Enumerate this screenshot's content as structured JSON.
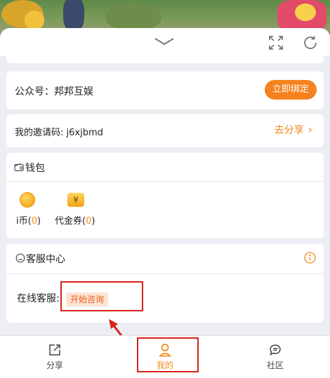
{
  "colors": {
    "accent": "#f5821f",
    "link": "#f08a1d",
    "highlight": "#d7221a",
    "tab_active": "#f08a1d"
  },
  "header": {
    "collapse_icon": "chevron-down-icon",
    "fullscreen_icon": "expand-icon",
    "refresh_icon": "refresh-icon"
  },
  "official_account": {
    "label": "公众号：邦邦互娱",
    "button": "立即绑定"
  },
  "invite": {
    "label": "我的邀请码: j6xjbmd",
    "share": "去分享",
    "arrow": "›"
  },
  "wallet": {
    "title": "钱包",
    "items": [
      {
        "name": "i币",
        "open": "(",
        "count": "0",
        "close": ")"
      },
      {
        "name": "代金券",
        "open": "(",
        "count": "0",
        "close": ")"
      }
    ],
    "voucher_symbol": "¥"
  },
  "support": {
    "title": "客服中心",
    "online_label": "在线客服:",
    "consult": "开始咨询"
  },
  "tabs": [
    {
      "label": "分享",
      "icon": "share-icon",
      "active": false
    },
    {
      "label": "我的",
      "icon": "user-icon",
      "active": true
    },
    {
      "label": "社区",
      "icon": "chat-icon",
      "active": false
    }
  ]
}
